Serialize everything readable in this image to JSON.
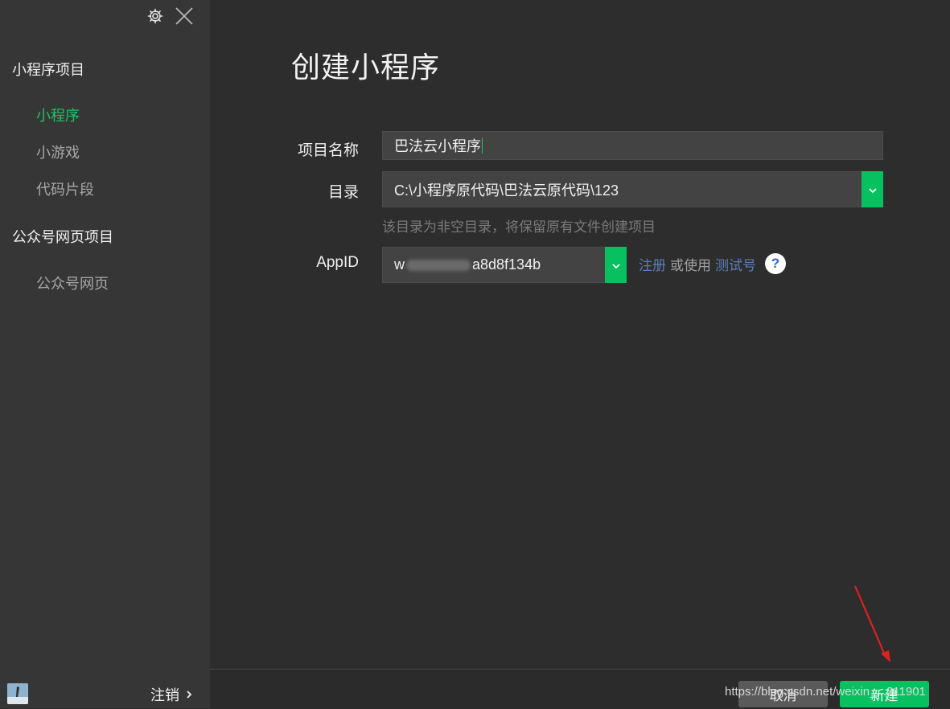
{
  "sidebar": {
    "sections": [
      {
        "title": "小程序项目",
        "items": [
          "小程序",
          "小游戏",
          "代码片段"
        ]
      },
      {
        "title": "公众号网页项目",
        "items": [
          "公众号网页"
        ]
      }
    ],
    "active_item": "小程序",
    "logout_label": "注销"
  },
  "page": {
    "title": "创建小程序",
    "form": {
      "project_name_label": "项目名称",
      "project_name_value": "巴法云小程序",
      "directory_label": "目录",
      "directory_value": "C:\\小程序原代码\\巴法云原代码\\123",
      "directory_hint": "该目录为非空目录，将保留原有文件创建项目",
      "appid_label": "AppID",
      "appid_prefix": "w",
      "appid_suffix": "a8d8f134b",
      "register_link": "注册",
      "or_use_text": "或使用",
      "test_account_link": "测试号",
      "help_symbol": "?"
    }
  },
  "footer": {
    "cancel_label": "取消",
    "create_label": "新建",
    "watermark": "https://blog.csdn.net/weixin_...211901"
  },
  "colors": {
    "accent_green": "#07c160",
    "link_blue": "#5c7db8",
    "annotation_red": "#e02020"
  }
}
